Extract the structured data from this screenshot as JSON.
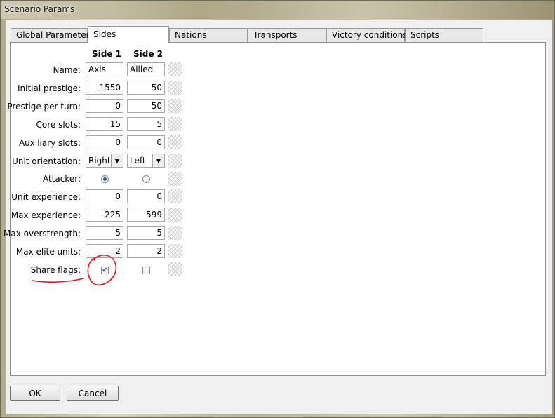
{
  "window": {
    "title": "Scenario Params"
  },
  "tabs": [
    {
      "label": "Global Parameters"
    },
    {
      "label": "Sides",
      "active": true
    },
    {
      "label": "Nations"
    },
    {
      "label": "Transports"
    },
    {
      "label": "Victory conditions"
    },
    {
      "label": "Scripts"
    }
  ],
  "sides": {
    "headers": {
      "side1": "Side 1",
      "side2": "Side 2"
    },
    "rows": [
      {
        "label": "Name:",
        "side1": "Axis",
        "side2": "Allied"
      },
      {
        "label": "Initial prestige:",
        "side1": "1550",
        "side2": "50"
      },
      {
        "label": "Prestige per turn:",
        "side1": "0",
        "side2": "50"
      },
      {
        "label": "Core slots:",
        "side1": "15",
        "side2": "5"
      },
      {
        "label": "Auxiliary slots:",
        "side1": "0",
        "side2": "0"
      },
      {
        "label": "Unit orientation:",
        "side1": "Right",
        "side2": "Left"
      },
      {
        "label": "Attacker:",
        "side1_selected": true,
        "side2_selected": false
      },
      {
        "label": "Unit experience:",
        "side1": "0",
        "side2": "0"
      },
      {
        "label": "Max experience:",
        "side1": "225",
        "side2": "599"
      },
      {
        "label": "Max overstrength:",
        "side1": "5",
        "side2": "5"
      },
      {
        "label": "Max elite units:",
        "side1": "2",
        "side2": "2"
      },
      {
        "label": "Share flags:",
        "side1_checked": true,
        "side2_checked": false
      }
    ]
  },
  "buttons": {
    "ok": "OK",
    "cancel": "Cancel"
  },
  "colors": {
    "annotation": "#e0151d",
    "radio_dot": "#1f5f9c"
  }
}
